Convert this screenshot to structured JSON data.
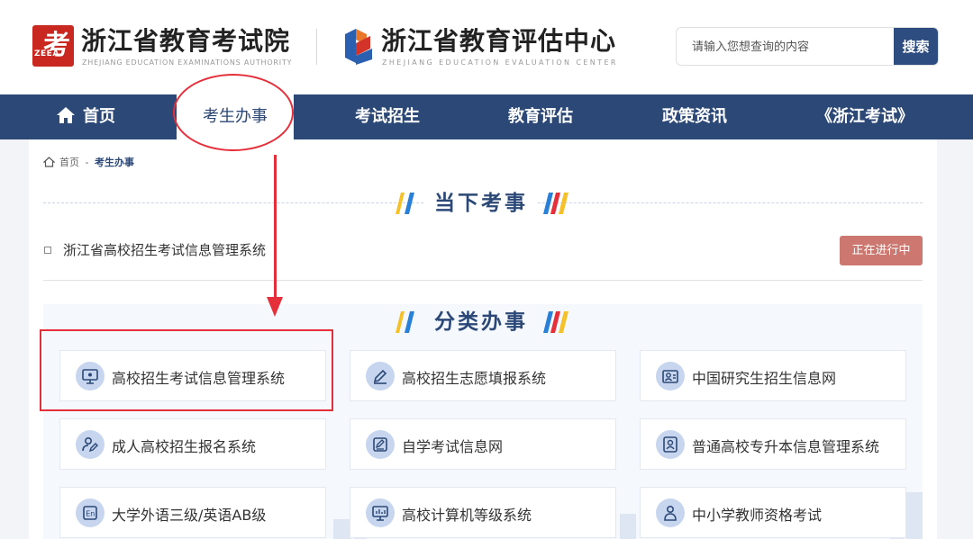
{
  "header": {
    "org1": {
      "logo_text": "考",
      "logo_abbr": "ZEEA",
      "logo_small": "Zhejiang Education Examinations Authority",
      "title": "浙江省教育考试院",
      "subtitle": "ZHEJIANG EDUCATION EXAMINATIONS AUTHORITY"
    },
    "org2": {
      "title": "浙江省教育评估中心",
      "subtitle": "ZHEJIANG EDUCATION EVALUATION CENTER"
    },
    "search": {
      "placeholder": "请输入您想查询的内容",
      "button": "搜索"
    }
  },
  "nav": {
    "items": [
      "首页",
      "考生办事",
      "考试招生",
      "教育评估",
      "政策资讯",
      "《浙江考试》"
    ],
    "active": "考生办事"
  },
  "breadcrumb": {
    "home": "首页",
    "separator": "-",
    "current": "考生办事"
  },
  "current_section": {
    "title": "当下考事",
    "items": [
      {
        "label": "浙江省高校招生考试信息管理系统",
        "status": "正在进行中"
      }
    ]
  },
  "category_section": {
    "title": "分类办事",
    "cards": [
      {
        "label": "高校招生考试信息管理系统",
        "icon": "monitor-icon"
      },
      {
        "label": "高校招生志愿填报系统",
        "icon": "pencil-icon"
      },
      {
        "label": "中国研究生招生信息网",
        "icon": "id-card-icon"
      },
      {
        "label": "成人高校招生报名系统",
        "icon": "user-edit-icon"
      },
      {
        "label": "自学考试信息网",
        "icon": "edit-doc-icon"
      },
      {
        "label": "普通高校专升本信息管理系统",
        "icon": "user-card-icon"
      },
      {
        "label": "大学外语三级/英语AB级",
        "icon": "english-icon"
      },
      {
        "label": "高校计算机等级系统",
        "icon": "chart-monitor-icon"
      },
      {
        "label": "中小学教师资格考试",
        "icon": "teacher-icon"
      }
    ]
  },
  "colors": {
    "navy": "#2b4877",
    "badge": "#cc7770",
    "annotation_red": "#e5303b",
    "logo_red": "#c8281f"
  }
}
